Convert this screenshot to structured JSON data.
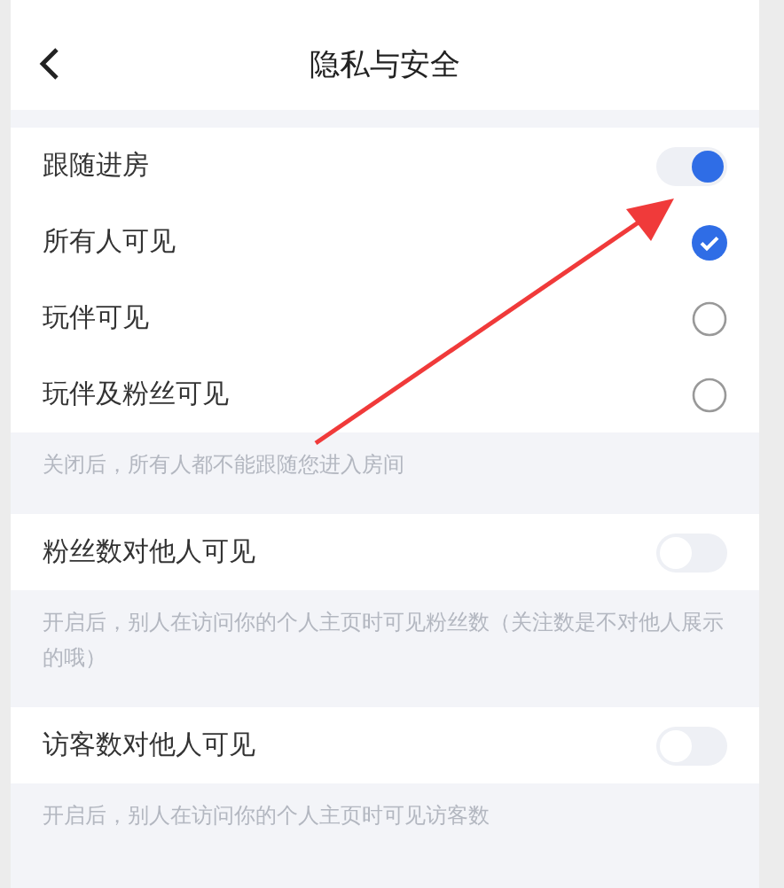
{
  "header": {
    "title": "隐私与安全"
  },
  "sections": [
    {
      "toggle": {
        "label": "跟随进房",
        "on": true
      },
      "options": [
        {
          "label": "所有人可见",
          "selected": true
        },
        {
          "label": "玩伴可见",
          "selected": false
        },
        {
          "label": "玩伴及粉丝可见",
          "selected": false
        }
      ],
      "hint": "关闭后，所有人都不能跟随您进入房间"
    },
    {
      "toggle": {
        "label": "粉丝数对他人可见",
        "on": false
      },
      "hint": "开启后，别人在访问你的个人主页时可见粉丝数（关注数是不对他人展示的哦）"
    },
    {
      "toggle": {
        "label": "访客数对他人可见",
        "on": false
      },
      "hint": "开启后，别人在访问你的个人主页时可见访客数"
    }
  ]
}
